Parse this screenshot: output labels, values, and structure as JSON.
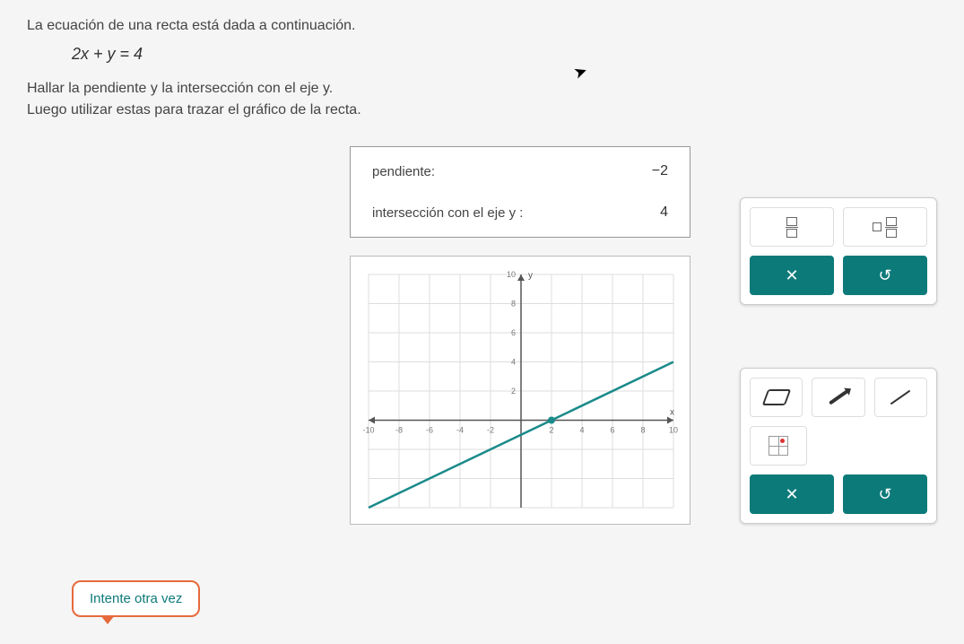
{
  "problem": {
    "intro": "La ecuación de una recta está dada a continuación.",
    "equation": "2x + y = 4",
    "instr1": "Hallar la pendiente y la intersección con el eje y.",
    "instr2": "Luego utilizar estas para trazar el gráfico de la recta."
  },
  "answers": {
    "slope_label": "pendiente:",
    "slope_value": "−2",
    "yint_label": "intersección con el eje y :",
    "yint_value": "4"
  },
  "retry_label": "Intente otra vez",
  "toolpanel_math": {
    "close": "✕",
    "undo": "↺"
  },
  "toolpanel_draw": {
    "close": "✕",
    "undo": "↺"
  },
  "chart_data": {
    "type": "line",
    "xlim": [
      -10,
      10
    ],
    "ylim": [
      -6,
      10
    ],
    "xticks": [
      -10,
      -8,
      -6,
      -4,
      -2,
      2,
      4,
      6,
      8,
      10
    ],
    "yticks": [
      2,
      4,
      6,
      8,
      10
    ],
    "grid": true,
    "series": [
      {
        "name": "user-drawn-line",
        "points": [
          [
            -10,
            -6
          ],
          [
            2,
            0
          ],
          [
            10,
            4
          ]
        ],
        "marker_point": [
          2,
          0
        ],
        "color": "#1a8a8a"
      }
    ],
    "axis_labels": {
      "x": "x",
      "y": "y"
    }
  }
}
